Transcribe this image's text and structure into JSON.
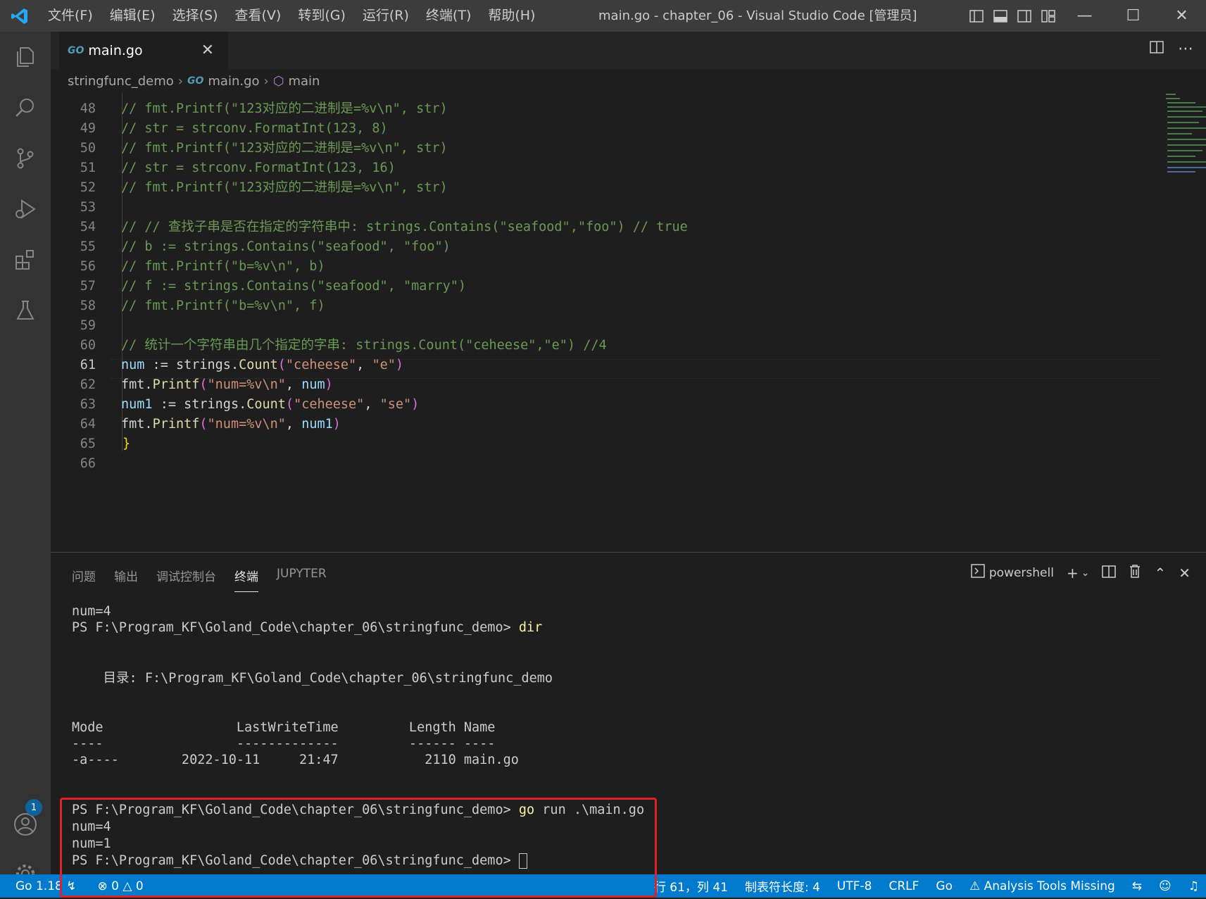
{
  "window": {
    "title": "main.go - chapter_06 - Visual Studio Code [管理员]",
    "menu": [
      "文件(F)",
      "编辑(E)",
      "选择(S)",
      "查看(V)",
      "转到(G)",
      "运行(R)",
      "终端(T)",
      "帮助(H)"
    ]
  },
  "activity": {
    "accounts_badge": "1"
  },
  "tab": {
    "icon": "GO",
    "label": "main.go"
  },
  "breadcrumb": {
    "folder": "stringfunc_demo",
    "file": "main.go",
    "symbol": "main"
  },
  "editor": {
    "current_line": "61",
    "lines": [
      {
        "n": "48",
        "text": "// fmt.Printf(\"123对应的二进制是=%v\\n\", str)"
      },
      {
        "n": "49",
        "text": "// str = strconv.FormatInt(123, 8)"
      },
      {
        "n": "50",
        "text": "// fmt.Printf(\"123对应的二进制是=%v\\n\", str)"
      },
      {
        "n": "51",
        "text": "// str = strconv.FormatInt(123, 16)"
      },
      {
        "n": "52",
        "text": "// fmt.Printf(\"123对应的二进制是=%v\\n\", str)"
      },
      {
        "n": "53",
        "text": ""
      },
      {
        "n": "54",
        "text": "// // 查找子串是否在指定的字符串中: strings.Contains(\"seafood\",\"foo\") // true"
      },
      {
        "n": "55",
        "text": "// b := strings.Contains(\"seafood\", \"foo\")"
      },
      {
        "n": "56",
        "text": "// fmt.Printf(\"b=%v\\n\", b)"
      },
      {
        "n": "57",
        "text": "// f := strings.Contains(\"seafood\", \"marry\")"
      },
      {
        "n": "58",
        "text": "// fmt.Printf(\"b=%v\\n\", f)"
      },
      {
        "n": "59",
        "text": ""
      },
      {
        "n": "60",
        "text": "// 统计一个字符串由几个指定的字串: strings.Count(\"ceheese\",\"e\") //4"
      },
      {
        "n": "61",
        "text": ""
      },
      {
        "n": "62",
        "text": ""
      },
      {
        "n": "63",
        "text": ""
      },
      {
        "n": "64",
        "text": ""
      },
      {
        "n": "65",
        "text": "}"
      },
      {
        "n": "66",
        "text": ""
      }
    ],
    "l61": {
      "a": "num",
      "b": " := strings.",
      "c": "Count",
      "d": "(",
      "e": "\"ceheese\"",
      "f": ", ",
      "g": "\"e\"",
      "h": ")"
    },
    "l62": {
      "a": "fmt.",
      "b": "Printf",
      "c": "(",
      "d": "\"num=%v\\n\"",
      "e": ", ",
      "f": "num",
      "g": ")"
    },
    "l63": {
      "a": "num1",
      "b": " := strings.",
      "c": "Count",
      "d": "(",
      "e": "\"ceheese\"",
      "f": ", ",
      "g": "\"se\"",
      "h": ")"
    },
    "l64": {
      "a": "fmt.",
      "b": "Printf",
      "c": "(",
      "d": "\"num=%v\\n\"",
      "e": ", ",
      "f": "num1",
      "g": ")"
    }
  },
  "panel": {
    "tabs": [
      "问题",
      "输出",
      "调试控制台",
      "终端",
      "JUPYTER"
    ],
    "active_tab": "终端",
    "shell": "powershell",
    "terminal": {
      "l1": "num=4",
      "l2_prompt": "PS F:\\Program_KF\\Goland_Code\\chapter_06\\stringfunc_demo> ",
      "l2_cmd": "dir",
      "l3": "    目录: F:\\Program_KF\\Goland_Code\\chapter_06\\stringfunc_demo",
      "l4": "Mode                 LastWriteTime         Length Name",
      "l5": "----                 -------------         ------ ----",
      "l6": "-a----        2022-10-11     21:47           2110 main.go",
      "l7_prompt": "PS F:\\Program_KF\\Goland_Code\\chapter_06\\stringfunc_demo> ",
      "l7_cmd": "go",
      "l7_args": " run .\\main.go",
      "l8": "num=4",
      "l9": "num=1",
      "l10_prompt": "PS F:\\Program_KF\\Goland_Code\\chapter_06\\stringfunc_demo> "
    }
  },
  "status": {
    "go_version": "Go 1.18",
    "errors": "0",
    "warnings": "0",
    "position": "行 61，列 41",
    "tab_size": "制表符长度: 4",
    "encoding": "UTF-8",
    "eol": "CRLF",
    "language": "Go",
    "analysis": "Analysis Tools Missing"
  },
  "colors": {
    "accent": "#007acc",
    "highlight_box": "#e0202a"
  }
}
